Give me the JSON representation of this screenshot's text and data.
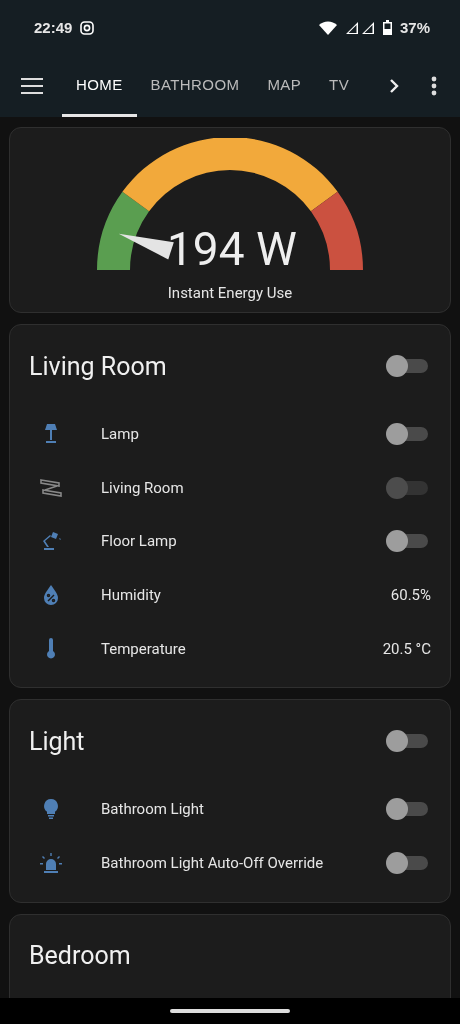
{
  "status_bar": {
    "time": "22:49",
    "battery": "37%"
  },
  "tabs": [
    {
      "label": "HOME",
      "selected": true
    },
    {
      "label": "BATHROOM",
      "selected": false
    },
    {
      "label": "MAP",
      "selected": false
    },
    {
      "label": "TV",
      "selected": false
    }
  ],
  "gauge": {
    "value": "194 W",
    "label": "Instant Energy Use"
  },
  "cards": [
    {
      "title": "Living Room",
      "on": false,
      "entities": [
        {
          "kind": "switch",
          "name": "Lamp",
          "on": false,
          "disabled": false
        },
        {
          "kind": "switch",
          "name": "Living Room",
          "on": false,
          "disabled": true
        },
        {
          "kind": "switch",
          "name": "Floor Lamp",
          "on": false,
          "disabled": false
        },
        {
          "kind": "sensor",
          "name": "Humidity",
          "value": "60.5%"
        },
        {
          "kind": "sensor",
          "name": "Temperature",
          "value": "20.5 °C"
        }
      ]
    },
    {
      "title": "Light",
      "on": false,
      "entities": [
        {
          "kind": "switch",
          "name": "Bathroom Light",
          "on": false,
          "disabled": false
        },
        {
          "kind": "switch",
          "name": "Bathroom Light Auto-Off Override",
          "on": false,
          "disabled": false
        }
      ]
    },
    {
      "title": "Bedroom"
    }
  ]
}
